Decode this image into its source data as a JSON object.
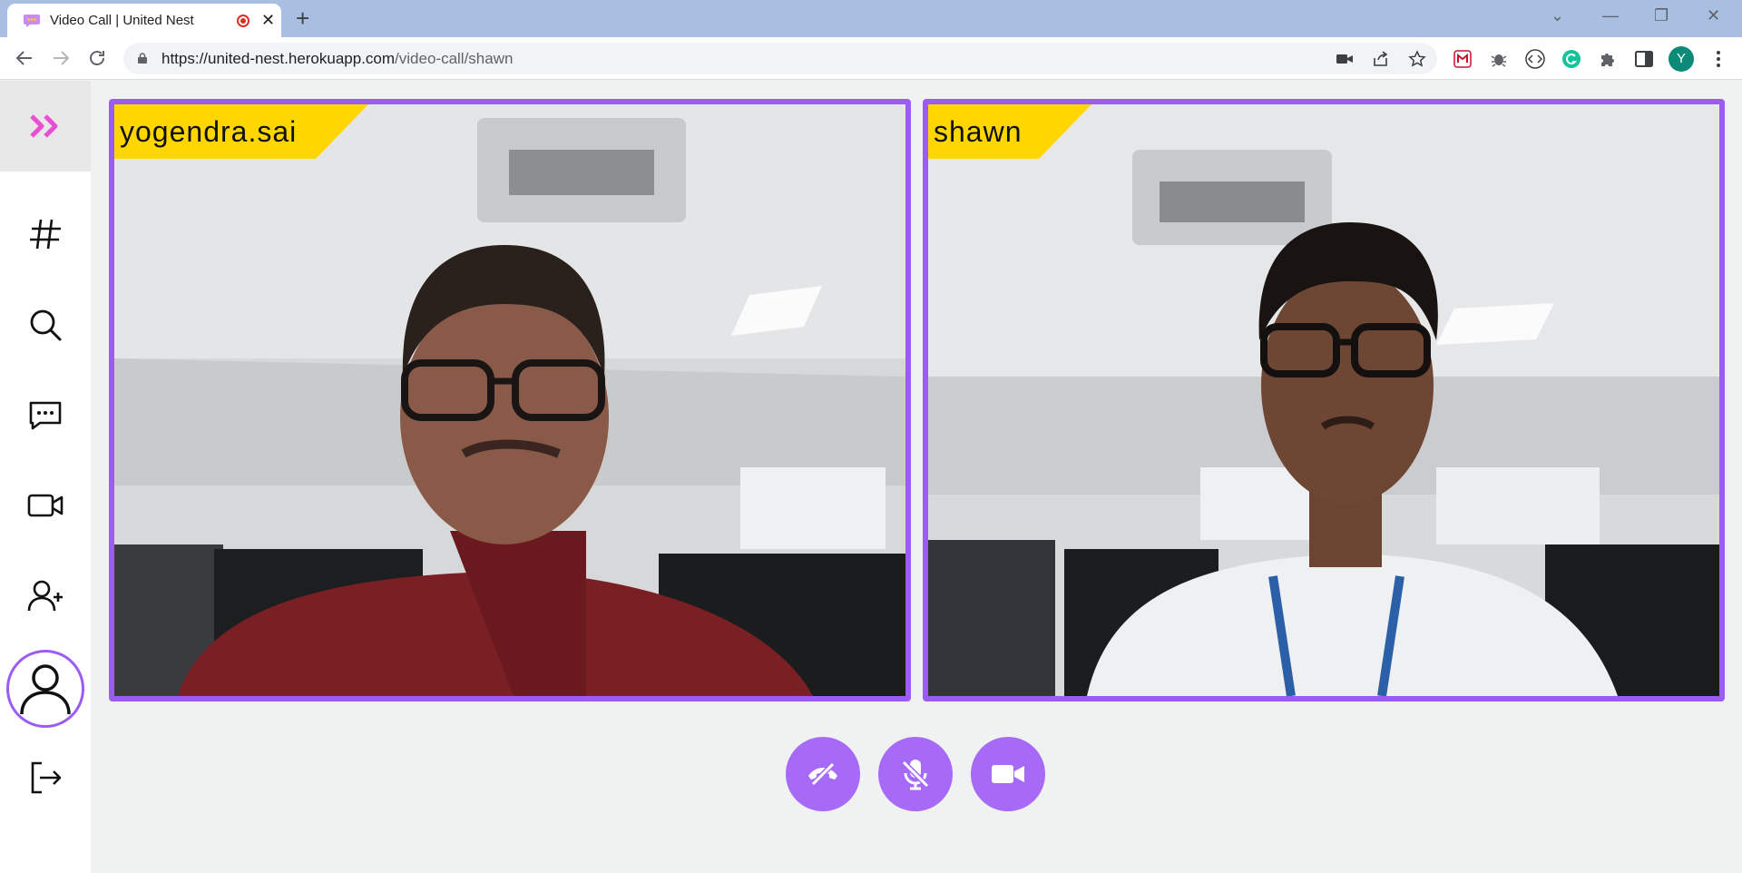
{
  "browser": {
    "tab_title": "Video Call | United Nest",
    "tab_close": "✕",
    "new_tab": "+",
    "url_host": "https://united-nest.herokuapp.com",
    "url_path": "/video-call/shawn",
    "profile_initial": "Y",
    "window_controls": {
      "tab_search": "⌄",
      "minimize": "—",
      "restore": "❐",
      "close": "✕"
    }
  },
  "sidebar": {
    "logo_icon": "double-chevron-right-icon",
    "items": [
      {
        "name": "channels",
        "icon": "hash-icon"
      },
      {
        "name": "search",
        "icon": "search-icon"
      },
      {
        "name": "messages",
        "icon": "chat-icon"
      },
      {
        "name": "video-call",
        "icon": "video-icon"
      },
      {
        "name": "add-friend",
        "icon": "add-user-icon"
      },
      {
        "name": "profile",
        "icon": "user-icon"
      },
      {
        "name": "logout",
        "icon": "logout-icon"
      }
    ]
  },
  "call": {
    "participants": [
      {
        "name": "yogendra.sai"
      },
      {
        "name": "shawn"
      }
    ],
    "controls": [
      {
        "name": "end-call",
        "icon": "phone-hangup-icon"
      },
      {
        "name": "mute",
        "icon": "mic-off-icon"
      },
      {
        "name": "camera",
        "icon": "video-camera-icon"
      }
    ]
  },
  "colors": {
    "accent": "#9b5cf6",
    "button": "#a66af7",
    "name_tag": "#ffd600",
    "logo": "#e84fd3"
  }
}
